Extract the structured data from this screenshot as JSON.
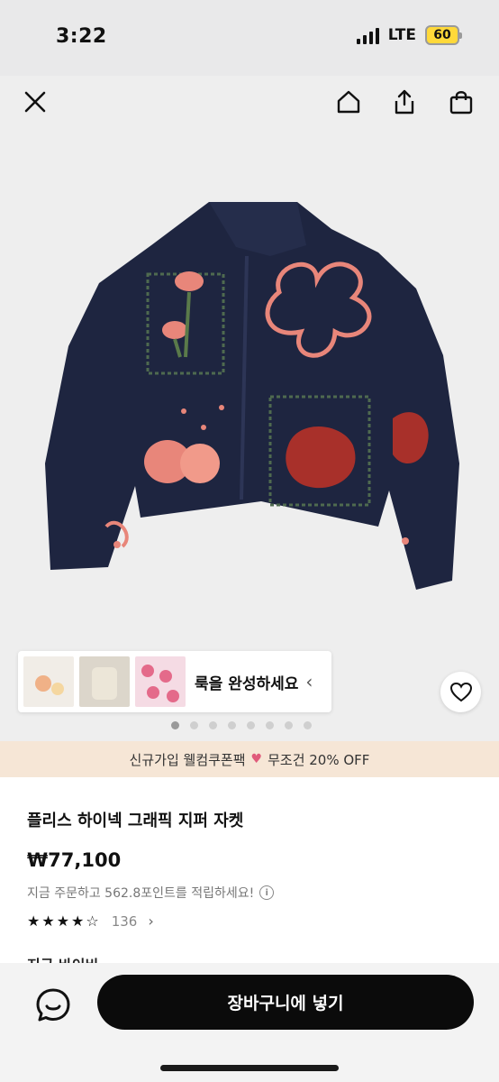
{
  "status_bar": {
    "time": "3:22",
    "network": "LTE",
    "battery": "60"
  },
  "nav": {
    "close_icon": "close-icon",
    "home_icon": "home-icon",
    "share_icon": "share-icon",
    "bag_icon": "bag-icon"
  },
  "style_strip": {
    "text": "룩을 완성하세요",
    "chevron": "‹"
  },
  "gallery": {
    "dot_count": 8,
    "active_index": 0
  },
  "promo": {
    "left_text": "신규가입 웰컴쿠폰팩",
    "right_text": "무조건 20% OFF"
  },
  "product": {
    "name": "플리스 하이넥 그래픽 지퍼 자켓",
    "price": "₩77,100",
    "points_text": "지금 주문하고 562.8포인트를 적립하세요!",
    "rating_value": 4.5,
    "review_count": "136"
  },
  "partial_section_title": "지금 바이비",
  "bottom": {
    "cart_label": "장바구니에 넣기",
    "chat_icon": "chat-icon"
  },
  "colors": {
    "accent_black": "#0b0b0b",
    "promo_bg": "#f6e6d6",
    "battery_yellow": "#ffd93a",
    "jacket_navy": "#1e2540",
    "pattern_pink": "#e8867a"
  }
}
